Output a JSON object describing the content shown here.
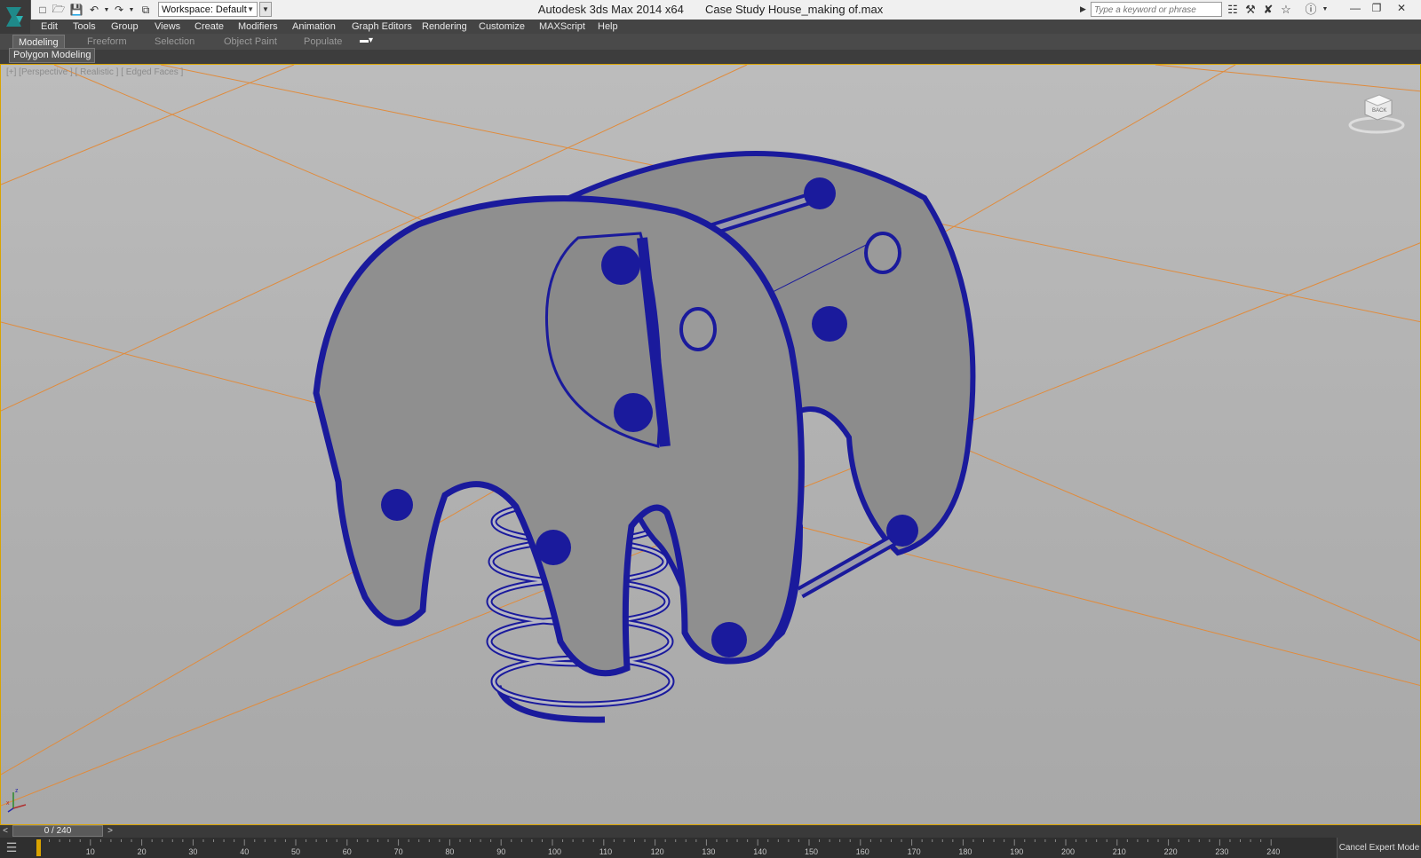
{
  "titlebar": {
    "app_name": "Autodesk 3ds Max  2014 x64",
    "file_name": "Case Study House_making of.max",
    "workspace": "Workspace: Default",
    "search_placeholder": "Type a keyword or phrase"
  },
  "menu": [
    "Edit",
    "Tools",
    "Group",
    "Views",
    "Create",
    "Modifiers",
    "Animation",
    "Graph Editors",
    "Rendering",
    "Customize",
    "MAXScript",
    "Help"
  ],
  "ribbon": {
    "tabs": [
      "Modeling",
      "Freeform",
      "Selection",
      "Object Paint",
      "Populate"
    ],
    "active_tab": "Modeling",
    "panel_label": "Polygon Modeling"
  },
  "viewport": {
    "label": "[+] [Perspective ] [ Realistic ] [ Edged Faces ]",
    "wire_color": "#1a1a9c",
    "surface_color": "#8a8a8a",
    "grid_color": "#e08b3c",
    "viewcube_label": "BACK"
  },
  "timeline": {
    "frame_display": "0 / 240",
    "ticks": [
      "10",
      "20",
      "30",
      "40",
      "50",
      "60",
      "70",
      "80",
      "90",
      "100",
      "110",
      "120",
      "130",
      "140",
      "150",
      "160",
      "170",
      "180",
      "190",
      "200",
      "210",
      "220",
      "230",
      "240"
    ]
  },
  "status": {
    "cancel_expert": "Cancel Expert Mode"
  }
}
